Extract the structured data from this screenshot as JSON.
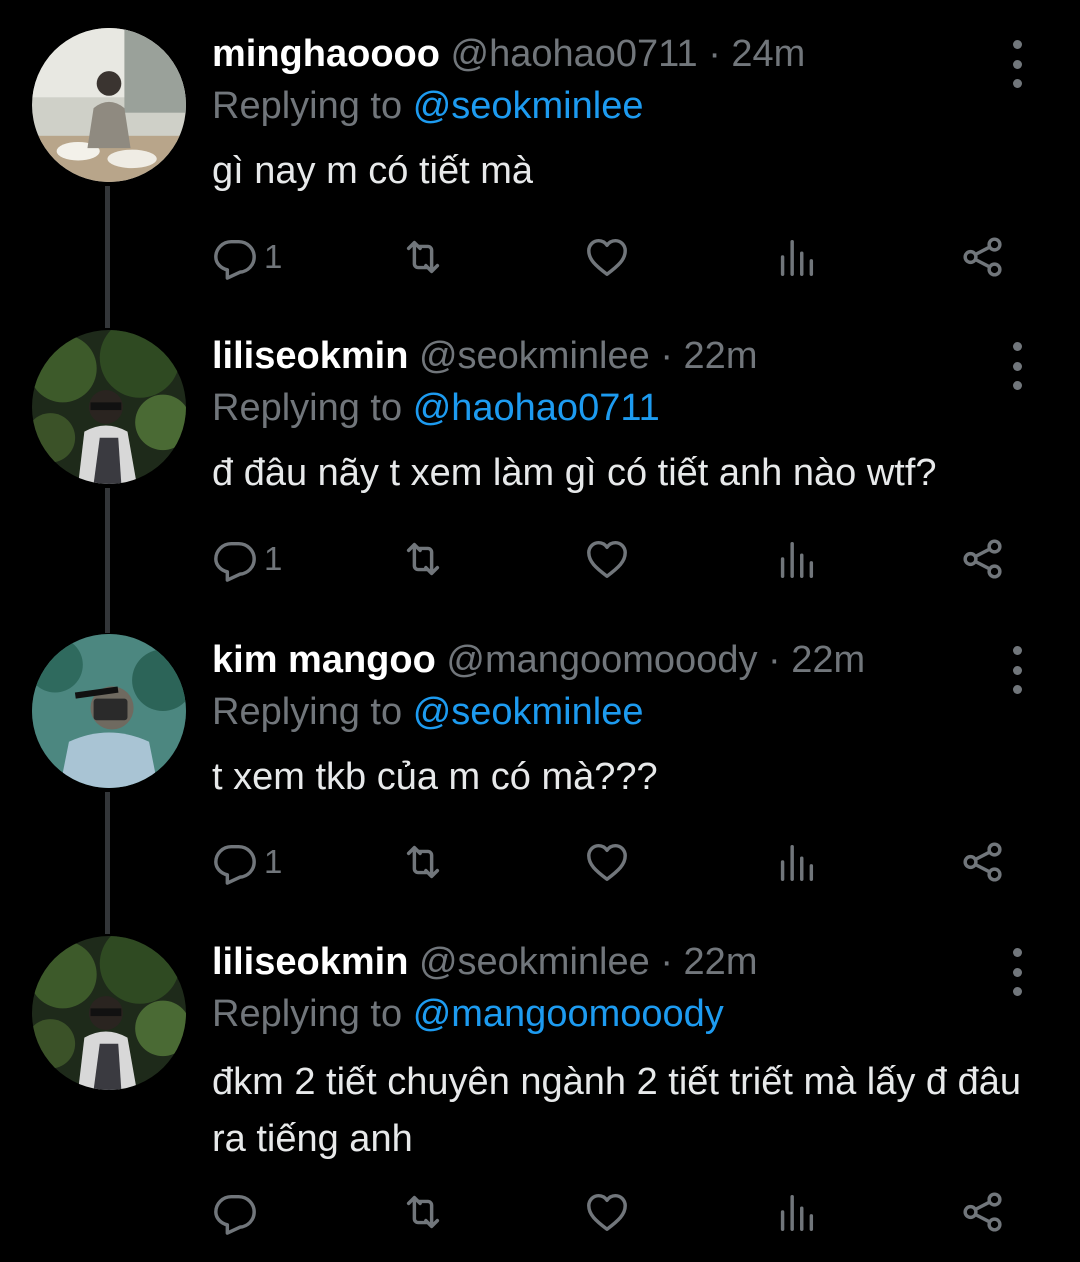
{
  "colors": {
    "background": "#000000",
    "secondary_text": "#71767b",
    "link": "#1d9bf0"
  },
  "icons": {
    "reply": "reply-icon",
    "retweet": "retweet-icon",
    "like": "heart-icon",
    "stats": "bar-chart-icon",
    "share": "share-icon",
    "more": "more-vertical-icon"
  },
  "tweets": [
    {
      "name": "minghaoooo",
      "handle": "@haohao0711",
      "separator": "·",
      "time": "24m",
      "reply_label": "Replying to",
      "reply_to": "@seokminlee",
      "text": "gì nay m có tiết mà",
      "reply_count": "1"
    },
    {
      "name": "liliseokmin",
      "handle": "@seokminlee",
      "separator": "·",
      "time": "22m",
      "reply_label": "Replying to",
      "reply_to": "@haohao0711",
      "text": "đ đâu nãy t xem làm gì có tiết anh nào wtf?",
      "reply_count": "1"
    },
    {
      "name": "kim mangoo",
      "handle": "@mangoomooody",
      "separator": "·",
      "time": "22m",
      "reply_label": "Replying to",
      "reply_to": "@seokminlee",
      "text": "t xem tkb của m có mà???",
      "reply_count": "1"
    },
    {
      "name": "liliseokmin",
      "handle": "@seokminlee",
      "separator": "·",
      "time": "22m",
      "reply_label": "Replying to",
      "reply_to": "@mangoomooody",
      "text": "đkm 2 tiết chuyên ngành 2 tiết triết mà lấy đ đâu ra tiếng anh",
      "reply_count": ""
    }
  ]
}
